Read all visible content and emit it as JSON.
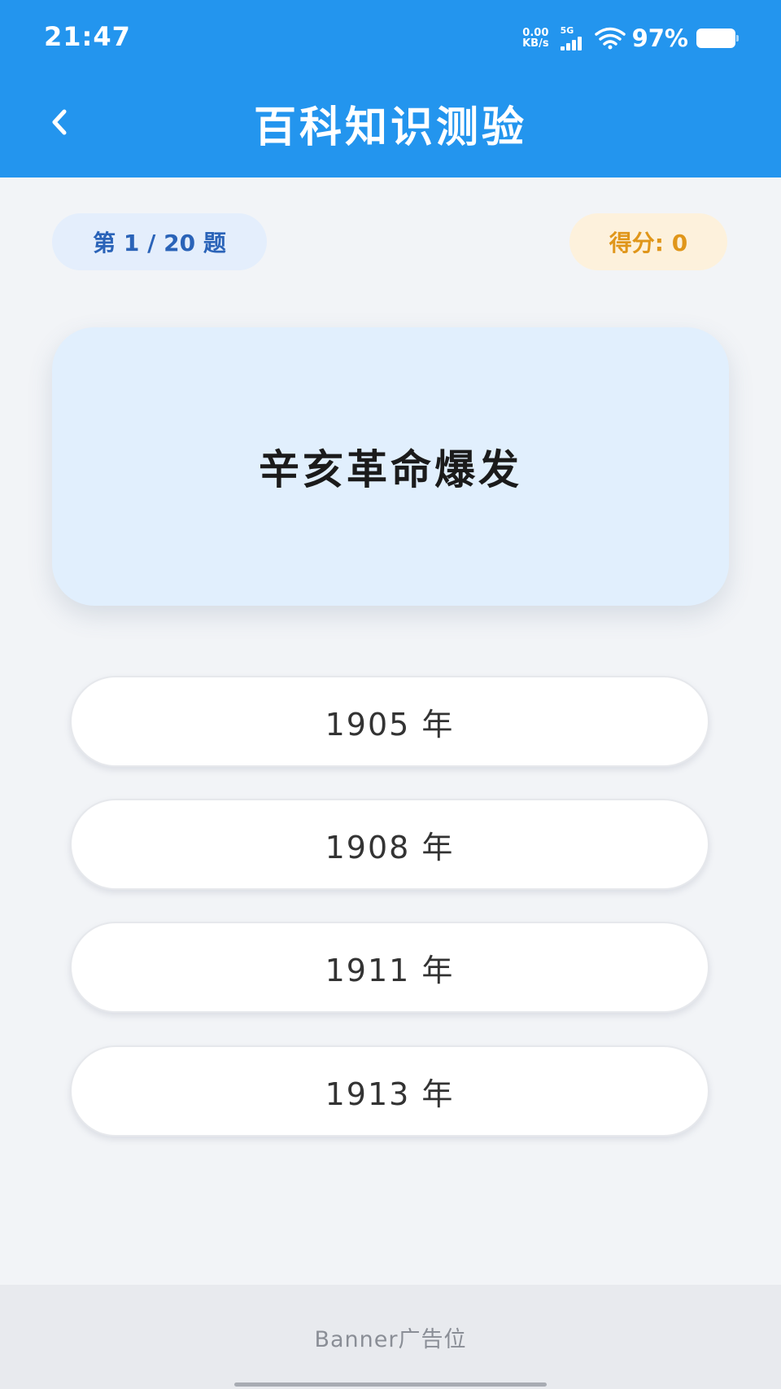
{
  "status_bar": {
    "time": "21:47",
    "net_speed_value": "0.00",
    "net_speed_unit": "KB/s",
    "network_type": "5G",
    "battery_percent": "97%"
  },
  "header": {
    "title": "百科知识测验",
    "back_icon": "chevron-left-icon"
  },
  "quiz": {
    "progress_label": "第 1 / 20 题",
    "score_label": "得分: 0",
    "question": "辛亥革命爆发",
    "options": [
      "1905 年",
      "1908 年",
      "1911 年",
      "1913 年"
    ]
  },
  "banner": {
    "label": "Banner广告位"
  },
  "colors": {
    "app_bar": "#2395ee",
    "question_card": "#e1effd",
    "progress_text": "#2a63b8",
    "score_text": "#e0961a"
  }
}
